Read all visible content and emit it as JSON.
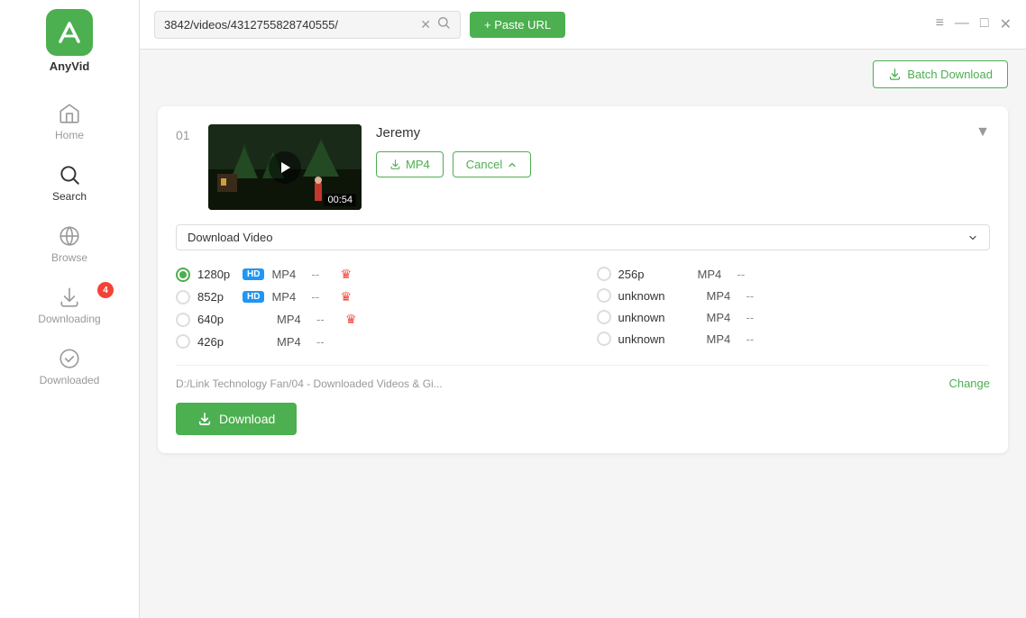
{
  "app": {
    "name": "AnyVid"
  },
  "topbar": {
    "url_value": "3842/videos/4312755828740555/",
    "paste_url_label": "+ Paste URL",
    "batch_download_label": "Batch Download",
    "window_controls": [
      "≡",
      "—",
      "□",
      "✕"
    ]
  },
  "sidebar": {
    "items": [
      {
        "id": "home",
        "label": "Home",
        "active": false
      },
      {
        "id": "search",
        "label": "Search",
        "active": true
      },
      {
        "id": "browse",
        "label": "Browse",
        "active": false
      },
      {
        "id": "downloading",
        "label": "Downloading",
        "active": false,
        "badge": "4"
      },
      {
        "id": "downloaded",
        "label": "Downloaded",
        "active": false
      }
    ]
  },
  "video_card": {
    "number": "01",
    "title": "Jeremy",
    "duration": "00:54",
    "mp4_button": "MP4",
    "cancel_button": "Cancel",
    "format_dropdown_label": "Download Video",
    "qualities": [
      {
        "id": "q1280",
        "res": "1280p",
        "hd": true,
        "format": "MP4",
        "size": "--",
        "premium": true,
        "selected": true,
        "side": "left"
      },
      {
        "id": "q852",
        "res": "852p",
        "hd": true,
        "format": "MP4",
        "size": "--",
        "premium": true,
        "selected": false,
        "side": "left"
      },
      {
        "id": "q640",
        "res": "640p",
        "hd": false,
        "format": "MP4",
        "size": "--",
        "premium": true,
        "selected": false,
        "side": "left"
      },
      {
        "id": "q426",
        "res": "426p",
        "hd": false,
        "format": "MP4",
        "size": "--",
        "premium": false,
        "selected": false,
        "side": "left"
      },
      {
        "id": "q256",
        "res": "256p",
        "hd": false,
        "format": "MP4",
        "size": "--",
        "premium": false,
        "selected": false,
        "side": "right"
      },
      {
        "id": "qunk1",
        "res": "unknown",
        "hd": false,
        "format": "MP4",
        "size": "--",
        "premium": false,
        "selected": false,
        "side": "right"
      },
      {
        "id": "qunk2",
        "res": "unknown",
        "hd": false,
        "format": "MP4",
        "size": "--",
        "premium": false,
        "selected": false,
        "side": "right"
      },
      {
        "id": "qunk3",
        "res": "unknown",
        "hd": false,
        "format": "MP4",
        "size": "--",
        "premium": false,
        "selected": false,
        "side": "right"
      }
    ],
    "save_path": "D:/Link Technology Fan/04 - Downloaded Videos & Gi...",
    "change_label": "Change",
    "download_button": "Download"
  }
}
